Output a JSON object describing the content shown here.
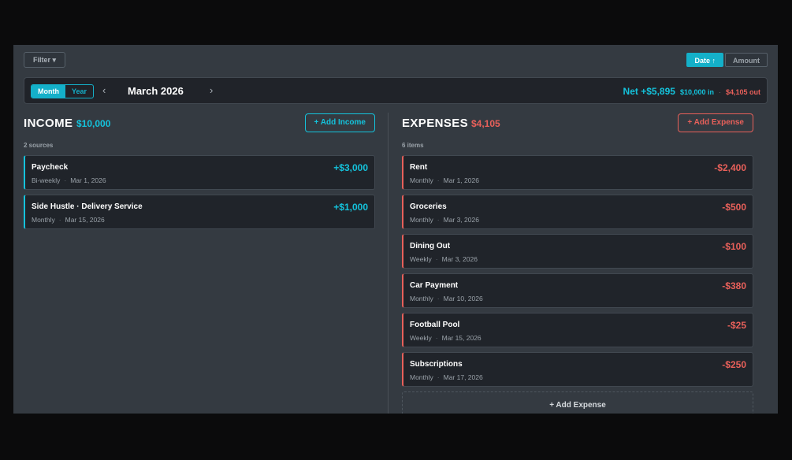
{
  "toolbar": {
    "filter_label": "Filter ▾",
    "sort_date_label": "Date ↑",
    "sort_amount_label": "Amount"
  },
  "period": {
    "modes": [
      "Month",
      "Year"
    ],
    "active_mode": "Month",
    "prev_icon": "‹",
    "next_icon": "›",
    "title": "March 2026",
    "net_label": "Net +$5,895",
    "in_label": "$10,000 in",
    "separator": "·",
    "out_label": "$4,105 out"
  },
  "income": {
    "title": "INCOME",
    "total": "$10,000",
    "add_label": "+ Add Income",
    "count_label": "2 sources",
    "items": [
      {
        "name": "Paycheck",
        "frequency": "Bi-weekly",
        "date": "Mar 1, 2026",
        "amount": "+$3,000"
      },
      {
        "name": "Side Hustle · Delivery Service",
        "frequency": "Monthly",
        "date": "Mar 15, 2026",
        "amount": "+$1,000"
      }
    ]
  },
  "expenses": {
    "title": "EXPENSES",
    "total": "$4,105",
    "add_label": "+ Add Expense",
    "count_label": "6 items",
    "add_bottom_label": "+ Add Expense",
    "items": [
      {
        "name": "Rent",
        "frequency": "Monthly",
        "date": "Mar 1, 2026",
        "amount": "-$2,400"
      },
      {
        "name": "Groceries",
        "frequency": "Monthly",
        "date": "Mar 3, 2026",
        "amount": "-$500"
      },
      {
        "name": "Dining Out",
        "frequency": "Weekly",
        "date": "Mar 3, 2026",
        "amount": "-$100"
      },
      {
        "name": "Car Payment",
        "frequency": "Monthly",
        "date": "Mar 10, 2026",
        "amount": "-$380"
      },
      {
        "name": "Football Pool",
        "frequency": "Weekly",
        "date": "Mar 15, 2026",
        "amount": "-$25"
      },
      {
        "name": "Subscriptions",
        "frequency": "Monthly",
        "date": "Mar 17, 2026",
        "amount": "-$250"
      }
    ]
  },
  "colors": {
    "accent_income": "#14c3dc",
    "accent_expense": "#e8605a",
    "panel_bg": "#343a41",
    "card_bg": "#20242a"
  }
}
